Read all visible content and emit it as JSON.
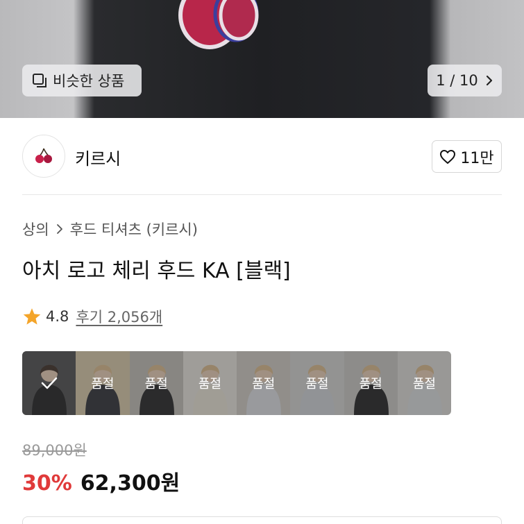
{
  "hero": {
    "similar_label": "비슷한 상품",
    "pager_label": "1 / 10",
    "colors": {
      "hoodie": "#1f2023",
      "cherry": "#b8264a",
      "outline": "#3b3f9e"
    }
  },
  "brand": {
    "name": "키르시",
    "like_count": "11만"
  },
  "breadcrumb": [
    "상의",
    "후드 티셔츠 (키르시)"
  ],
  "product": {
    "title": "아치 로고 체리 후드 KA [블랙]",
    "rating": "4.8",
    "reviews": "후기 2,056개"
  },
  "options": {
    "items": [
      {
        "tone": "#1c1c1e",
        "status": "",
        "selected": true
      },
      {
        "tone": "#2a2c33",
        "status": "품절",
        "selected": false
      },
      {
        "tone": "#202022",
        "status": "품절",
        "selected": false
      },
      {
        "tone": "#e8e4d6",
        "status": "품절",
        "selected": false
      },
      {
        "tone": "#dcdfe3",
        "status": "품절",
        "selected": false
      },
      {
        "tone": "#cfd3d8",
        "status": "품절",
        "selected": false
      },
      {
        "tone": "#1e1e20",
        "status": "품절",
        "selected": false
      },
      {
        "tone": "#d9dcdf",
        "status": "품절",
        "selected": false
      }
    ]
  },
  "price": {
    "original": "89,000원",
    "discount": "30%",
    "sale": "62,300원",
    "discount_color": "#e03a3a"
  }
}
